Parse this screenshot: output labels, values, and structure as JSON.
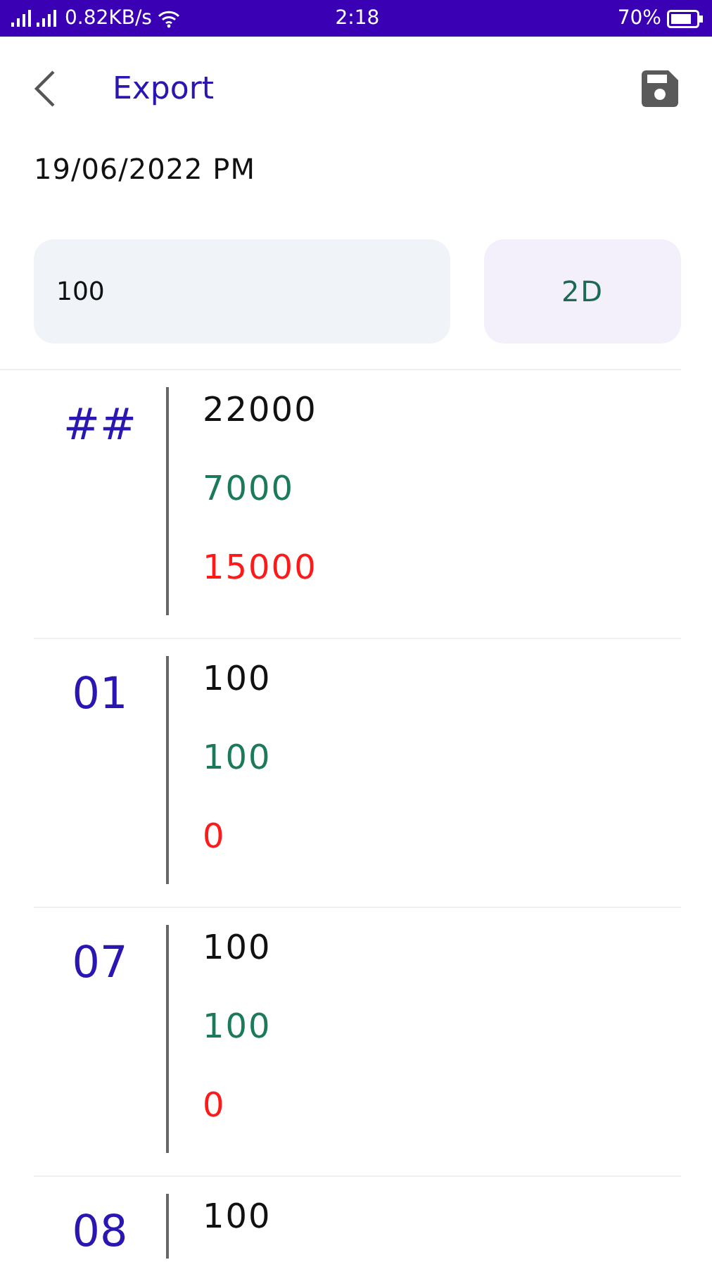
{
  "status_bar": {
    "network_speed": "0.82KB/s",
    "time": "2:18",
    "battery": "70%"
  },
  "header": {
    "title": "Export"
  },
  "date": "19/06/2022 PM",
  "amount_field": {
    "value": "100"
  },
  "mode_button": {
    "label": "2D"
  },
  "entries": [
    {
      "number": "##",
      "values": [
        {
          "kind": "total",
          "text": "22000"
        },
        {
          "kind": "paid",
          "text": "7000"
        },
        {
          "kind": "remaining",
          "text": "15000"
        }
      ]
    },
    {
      "number": "01",
      "values": [
        {
          "kind": "total",
          "text": "100"
        },
        {
          "kind": "paid",
          "text": "100"
        },
        {
          "kind": "remaining",
          "text": "0"
        }
      ]
    },
    {
      "number": "07",
      "values": [
        {
          "kind": "total",
          "text": "100"
        },
        {
          "kind": "paid",
          "text": "100"
        },
        {
          "kind": "remaining",
          "text": "0"
        }
      ]
    },
    {
      "number": "08",
      "values": [
        {
          "kind": "total",
          "text": "100"
        }
      ]
    }
  ]
}
